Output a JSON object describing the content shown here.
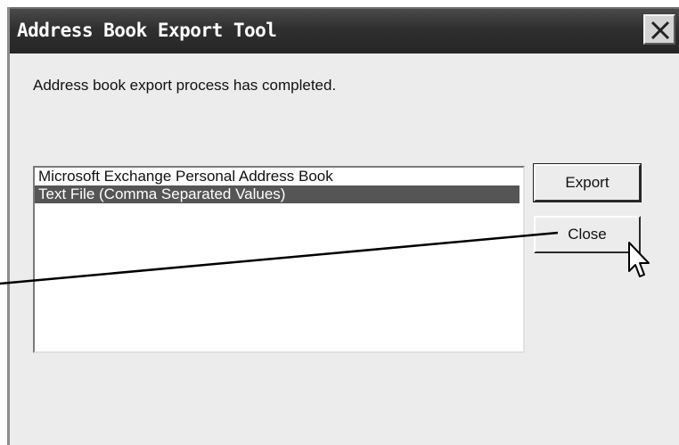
{
  "window": {
    "title": "Address Book Export Tool"
  },
  "message": "Address book export process has completed.",
  "list": {
    "items": [
      {
        "label": "Microsoft Exchange Personal Address Book",
        "selected": false
      },
      {
        "label": "Text File (Comma Separated Values)",
        "selected": true
      }
    ]
  },
  "buttons": {
    "export_label": "Export",
    "close_label": "Close"
  },
  "icons": {
    "close": "close-icon",
    "cursor": "mouse-pointer-icon"
  },
  "colors": {
    "titlebar": "#2f2f2f",
    "dialog_bg": "#ececec",
    "selection": "#555555"
  }
}
